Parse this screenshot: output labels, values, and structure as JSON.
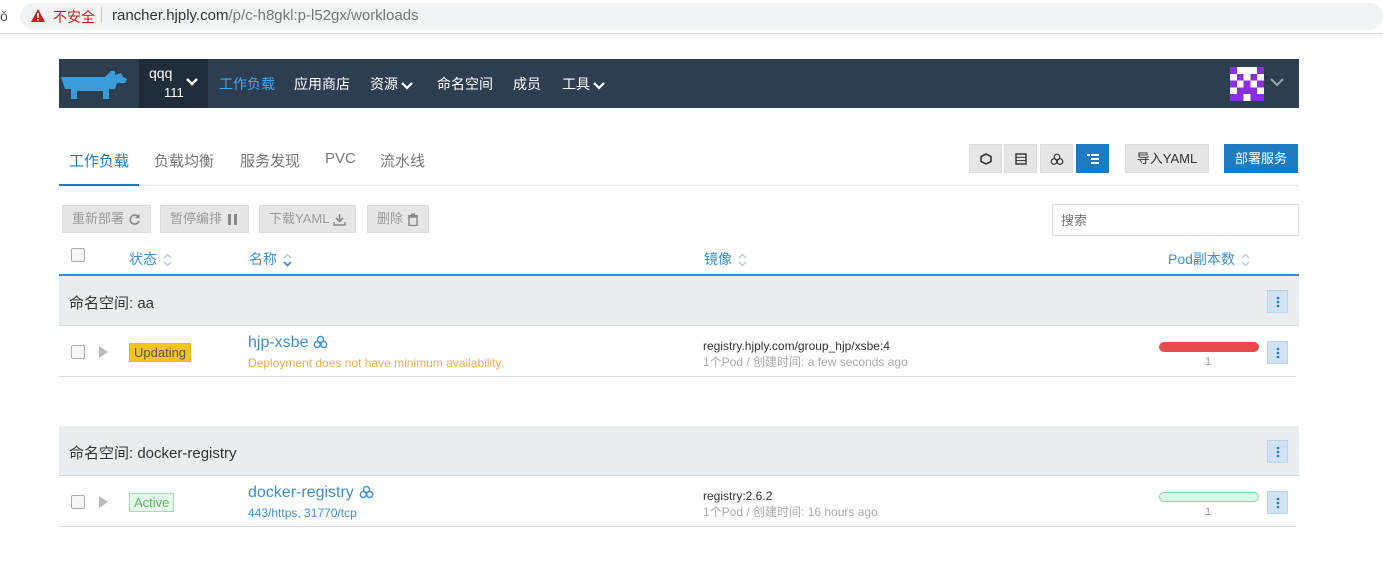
{
  "browser": {
    "insecure_label": "不安全",
    "url_host": "rancher.hjply.com",
    "url_path": "/p/c-h8gkl:p-l52gx/workloads"
  },
  "nav": {
    "cluster_name": "qqq",
    "project_name": "111",
    "items": [
      {
        "label": "工作负载",
        "active": true
      },
      {
        "label": "应用商店"
      },
      {
        "label": "资源",
        "dropdown": true
      },
      {
        "label": "命名空间"
      },
      {
        "label": "成员"
      },
      {
        "label": "工具",
        "dropdown": true
      }
    ]
  },
  "tabs": [
    "工作负载",
    "负载均衡",
    "服务发现",
    "PVC",
    "流水线"
  ],
  "toolbar": {
    "import_yaml": "导入YAML",
    "deploy": "部署服务"
  },
  "bulk_actions": {
    "redeploy": "重新部署",
    "pause": "暂停编排",
    "download_yaml": "下载YAML",
    "delete": "删除"
  },
  "search": {
    "placeholder": "搜索"
  },
  "columns": {
    "state": "状态",
    "name": "名称",
    "image": "镜像",
    "scale": "Pod副本数"
  },
  "groups": [
    {
      "label": "命名空间: aa",
      "rows": [
        {
          "state": "Updating",
          "name": "hjp-xsbe",
          "sub": "Deployment does not have minimum availability.",
          "image": "registry.hjply.com/group_hjp/xsbe:4",
          "meta": "1个Pod / 创建时间: a few seconds ago",
          "pods": "1"
        }
      ]
    },
    {
      "label": "命名空间: docker-registry",
      "rows": [
        {
          "state": "Active",
          "name": "docker-registry",
          "sub": "443/https, 31770/tcp",
          "image": "registry:2.6.2",
          "meta": "1个Pod / 创建时间: 16 hours ago",
          "pods": "1"
        }
      ]
    }
  ],
  "colors": {
    "navbar": "#2d3e50",
    "accent": "#1f7bc1",
    "updating": "#f4c51f",
    "active": "#5cb85c",
    "error_bar": "#e74c4c"
  }
}
